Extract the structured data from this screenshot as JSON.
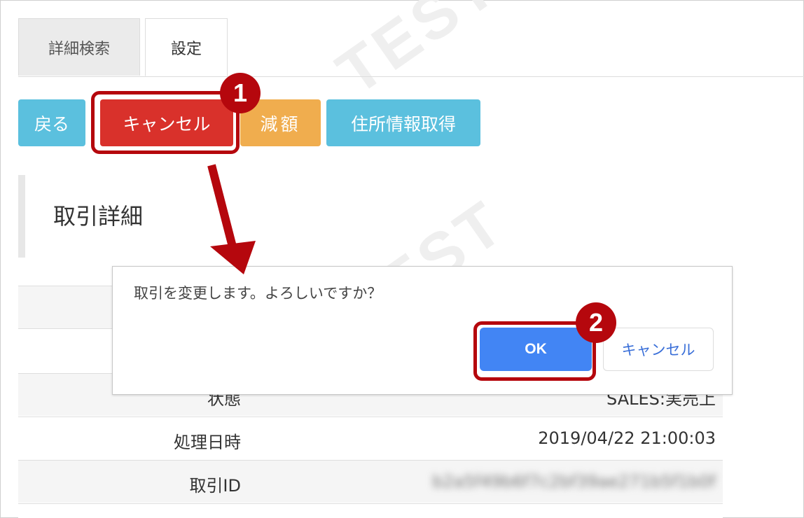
{
  "tabs": [
    {
      "label": "詳細検索"
    },
    {
      "label": "設定"
    }
  ],
  "toolbar": {
    "back_label": "戻る",
    "cancel_label": "キャンセル",
    "reduce_label": "減額",
    "address_label": "住所情報取得"
  },
  "section": {
    "title": "取引詳細"
  },
  "table": {
    "rows": [
      {
        "label": "状態",
        "value": "SALES:実売上"
      },
      {
        "label": "処理日時",
        "value": "2019/04/22 21:00:03"
      },
      {
        "label": "取引ID",
        "value": "b2a5f49b6f7c2bf39ae271b5f1b0f"
      }
    ]
  },
  "dialog": {
    "message": "取引を変更します。よろしいですか？",
    "ok_label": "OK",
    "cancel_label": "キャンセル"
  },
  "annotations": {
    "step1": "1",
    "step2": "2",
    "color": "#b5070d"
  },
  "watermark": "TEST"
}
